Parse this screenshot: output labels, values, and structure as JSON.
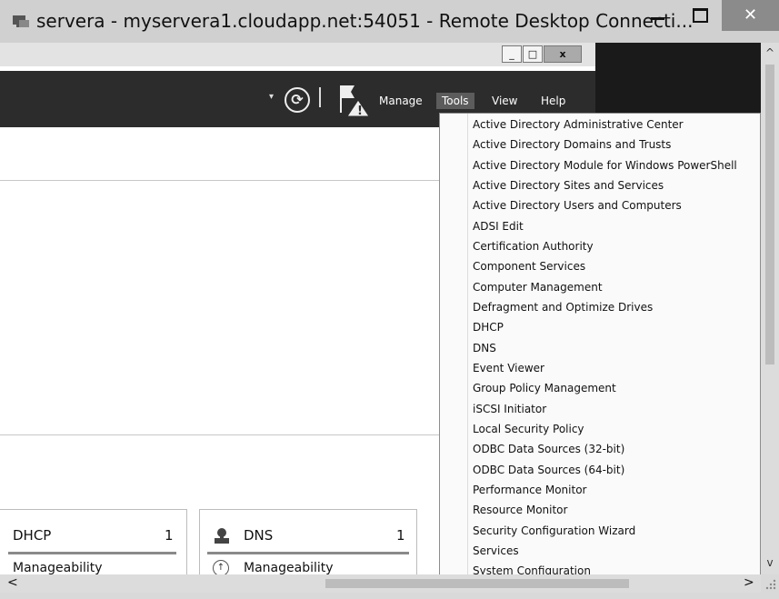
{
  "rdp": {
    "title": "servera - myservera1.cloudapp.net:54051 - Remote Desktop Connecti...",
    "min_glyph": "–",
    "max_glyph": "□",
    "close_glyph": "✕"
  },
  "inner_window": {
    "min_glyph": "_",
    "max_glyph": "□",
    "close_glyph": "x"
  },
  "menubar": {
    "dropdown_glyph": "▾",
    "refresh_glyph": "⟳",
    "items": [
      "Manage",
      "Tools",
      "View",
      "Help"
    ],
    "active": "Tools"
  },
  "tools_menu": {
    "items": [
      "Active Directory Administrative Center",
      "Active Directory Domains and Trusts",
      "Active Directory Module for Windows PowerShell",
      "Active Directory Sites and Services",
      "Active Directory Users and Computers",
      "ADSI Edit",
      "Certification Authority",
      "Component Services",
      "Computer Management",
      "Defragment and Optimize Drives",
      "DHCP",
      "DNS",
      "Event Viewer",
      "Group Policy Management",
      "iSCSI Initiator",
      "Local Security Policy",
      "ODBC Data Sources (32-bit)",
      "ODBC Data Sources (64-bit)",
      "Performance Monitor",
      "Resource Monitor",
      "Security Configuration Wizard",
      "Services",
      "System Configuration"
    ]
  },
  "tiles": {
    "dhcp": {
      "title": "DHCP",
      "count": "1",
      "sub": "Manageability"
    },
    "dns": {
      "title": "DNS",
      "count": "1",
      "sub": "Manageability"
    }
  },
  "scroll": {
    "up": "^",
    "down": "v",
    "left": "<",
    "right": ">"
  },
  "colors": {
    "menubar_bg": "#2c2c2c",
    "tools_highlight": "#5c5c5c",
    "rdp_close_bg": "#8b8b8b"
  }
}
